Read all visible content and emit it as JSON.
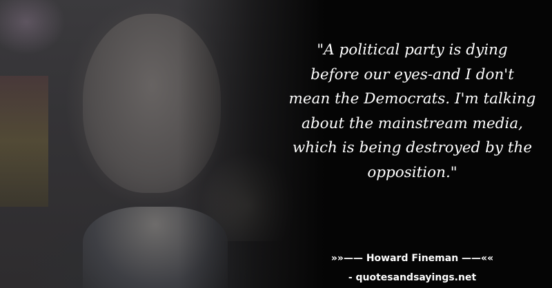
{
  "quote": {
    "lines": [
      "\"A political party is dying",
      "before our eyes-and I don't",
      "mean the Democrats. I'm talking",
      "about the mainstream media,",
      "which is being destroyed by the",
      "opposition.\""
    ]
  },
  "attribution": "»»—— Howard Fineman ——««",
  "site": "- quotesandsayings.net",
  "colors": {
    "background": "#050505",
    "text": "#ffffff"
  }
}
